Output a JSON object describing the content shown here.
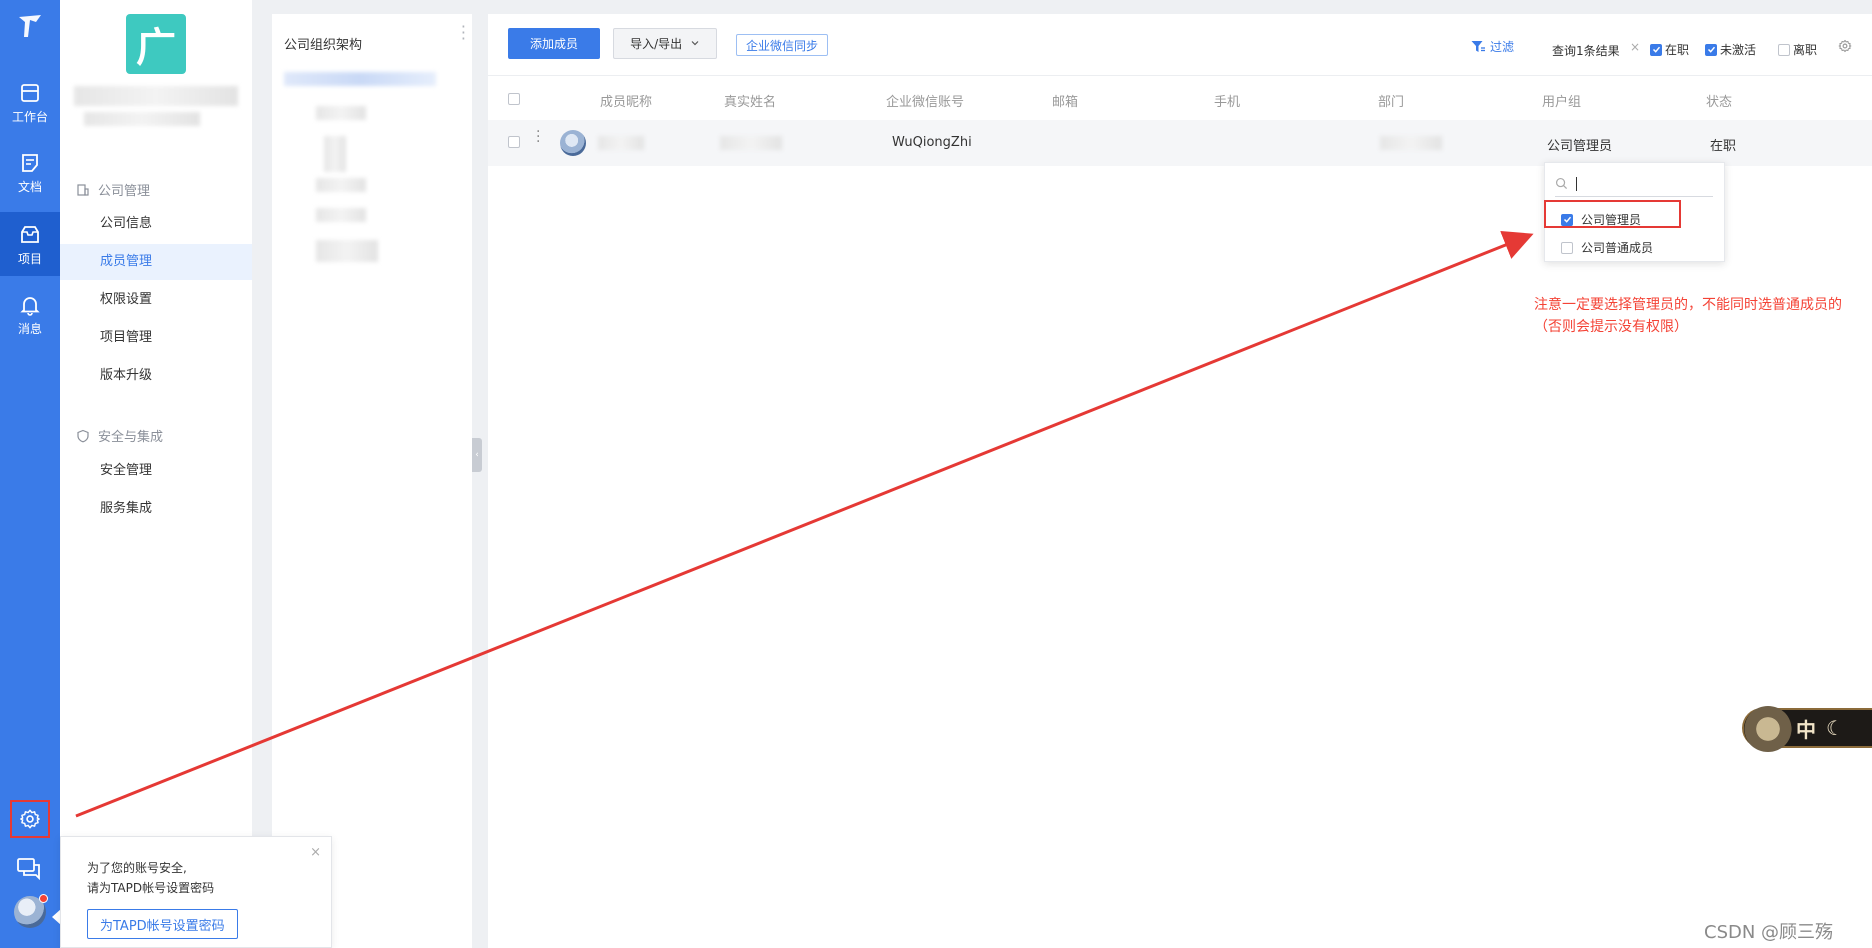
{
  "rail": {
    "items": [
      {
        "label": "工作台"
      },
      {
        "label": "文档"
      },
      {
        "label": "项目"
      },
      {
        "label": "消息"
      }
    ]
  },
  "sidebar": {
    "logo_char": "广",
    "section1": "公司管理",
    "items1": [
      {
        "label": "公司信息"
      },
      {
        "label": "成员管理"
      },
      {
        "label": "权限设置"
      },
      {
        "label": "项目管理"
      },
      {
        "label": "版本升级"
      }
    ],
    "section2": "安全与集成",
    "items2": [
      {
        "label": "安全管理"
      },
      {
        "label": "服务集成"
      }
    ]
  },
  "org": {
    "title": "公司组织架构"
  },
  "toolbar": {
    "add_member": "添加成员",
    "import_export": "导入/导出",
    "wechat_sync": "企业微信同步",
    "filter": "过滤",
    "result": "查询1条结果",
    "result_clear": "×",
    "chk_active": "在职",
    "chk_inactive": "未激活",
    "chk_left": "离职"
  },
  "table": {
    "headers": [
      "成员昵称",
      "真实姓名",
      "企业微信账号",
      "邮箱",
      "手机",
      "部门",
      "用户组",
      "状态"
    ],
    "row": {
      "wechat": "WuQiongZhi",
      "group": "公司管理员",
      "status": "在职"
    }
  },
  "dropdown": {
    "options": [
      {
        "label": "公司管理员",
        "checked": true
      },
      {
        "label": "公司普通成员",
        "checked": false
      }
    ]
  },
  "note": "注意一定要选择管理员的，不能同时选普通成员的（否则会提示没有权限）",
  "tip": {
    "line1": "为了您的账号安全,",
    "line2": "请为TAPD帐号设置密码",
    "button": "为TAPD帐号设置密码",
    "close": "×"
  },
  "badge": {
    "char": "中"
  },
  "watermark": "CSDN @顾三殇",
  "colors": {
    "primary": "#3a7be8",
    "annotation": "#e53935",
    "rail": "#3a7be8"
  }
}
